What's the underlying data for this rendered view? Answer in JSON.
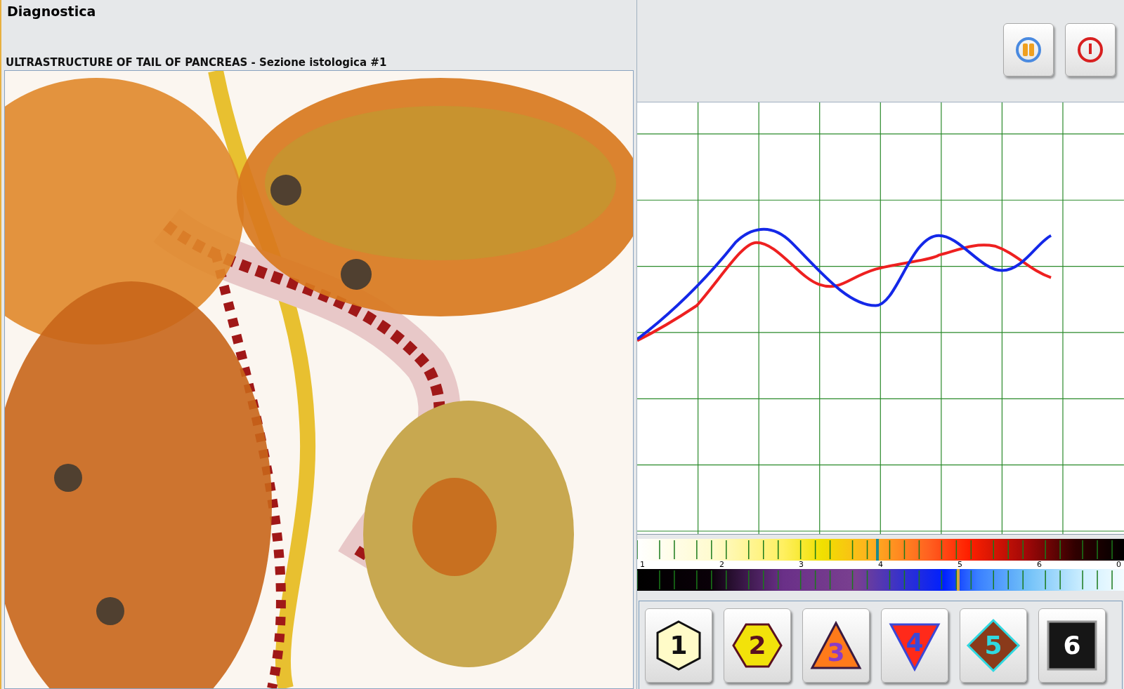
{
  "window": {
    "title": "Diagnostica"
  },
  "image_panel": {
    "caption": "ULTRASTRUCTURE OF TAIL OF PANCREAS - Sezione istologica #1"
  },
  "toolbar": [
    {
      "kind": "pause"
    },
    {
      "kind": "power"
    }
  ],
  "scales": [
    {
      "kind": "warm",
      "level": 0.49,
      "color": "#1f8a8a"
    },
    {
      "kind": "cool",
      "level": 0.657,
      "color": "#d4a640"
    }
  ],
  "scale_labels": [
    "1",
    "2",
    "3",
    "4",
    "5",
    "6",
    "0"
  ],
  "level_buttons": [
    {
      "label": "1",
      "kind": "hexagon",
      "color": "#fffbc8"
    },
    {
      "label": "2",
      "kind": "hexagon-wide",
      "color": "#f2e20a"
    },
    {
      "label": "3",
      "kind": "triangle",
      "color": "#ff7a1a"
    },
    {
      "label": "4",
      "kind": "triangle-down",
      "color": "#ff2a1a"
    },
    {
      "label": "5",
      "kind": "diamond",
      "color": "#8a3a1a"
    },
    {
      "label": "6",
      "kind": "square",
      "color": "#161616"
    }
  ]
}
